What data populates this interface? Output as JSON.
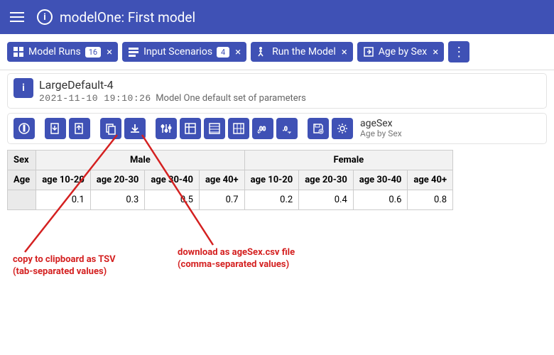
{
  "header": {
    "title": "modelOne: First model"
  },
  "tabs": [
    {
      "label": "Model Runs",
      "badge": "16"
    },
    {
      "label": "Input Scenarios",
      "badge": "4"
    },
    {
      "label": "Run the Model",
      "badge": null
    },
    {
      "label": "Age by Sex",
      "badge": null
    }
  ],
  "panel": {
    "title": "LargeDefault-4",
    "timestamp": "2021-11-10 19:10:26",
    "description": "Model One default set of parameters"
  },
  "param": {
    "name": "ageSex",
    "desc": "Age by Sex"
  },
  "table": {
    "corner_sex": "Sex",
    "corner_age": "Age",
    "sex_groups": [
      "Male",
      "Female"
    ],
    "age_cols": [
      "age 10-20",
      "age 20-30",
      "age 30-40",
      "age 40+"
    ],
    "values": {
      "Male": [
        "0.1",
        "0.3",
        "0.5",
        "0.7"
      ],
      "Female": [
        "0.2",
        "0.4",
        "0.6",
        "0.8"
      ]
    }
  },
  "annotations": {
    "copy": "copy to clipboard as TSV\n(tab-separated values)",
    "download": "download as ageSex.csv file\n(comma-separated values)"
  },
  "chart_data": {
    "type": "table",
    "title": "Age by Sex",
    "row_dim": "Sex",
    "col_dim": "Age",
    "columns": [
      "age 10-20",
      "age 20-30",
      "age 30-40",
      "age 40+"
    ],
    "series": [
      {
        "name": "Male",
        "values": [
          0.1,
          0.3,
          0.5,
          0.7
        ]
      },
      {
        "name": "Female",
        "values": [
          0.2,
          0.4,
          0.6,
          0.8
        ]
      }
    ]
  }
}
